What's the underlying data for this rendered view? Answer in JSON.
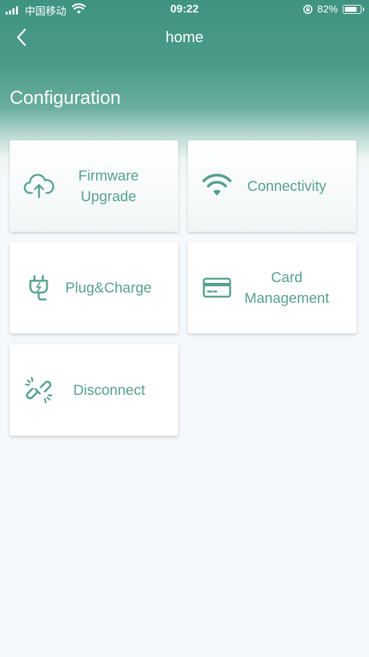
{
  "status_bar": {
    "carrier": "中国移动",
    "time": "09:22",
    "battery_percent": "82%",
    "battery_level": 0.82
  },
  "nav": {
    "title": "home",
    "back_icon": "chevron-left-icon"
  },
  "section": {
    "title": "Configuration"
  },
  "colors": {
    "accent": "#57a08f",
    "header": "#3f9481",
    "background": "#f6f9fb"
  },
  "cards": [
    {
      "label_lines": [
        "Firmware",
        "Upgrade"
      ],
      "icon": "cloud-upload-icon"
    },
    {
      "label_lines": [
        "Connectivity"
      ],
      "icon": "wifi-icon"
    },
    {
      "label_lines": [
        "Plug&Charge"
      ],
      "icon": "plug-icon"
    },
    {
      "label_lines": [
        "Card",
        "Management"
      ],
      "icon": "credit-card-icon"
    },
    {
      "label_lines": [
        "Disconnect"
      ],
      "icon": "unlink-icon"
    }
  ]
}
